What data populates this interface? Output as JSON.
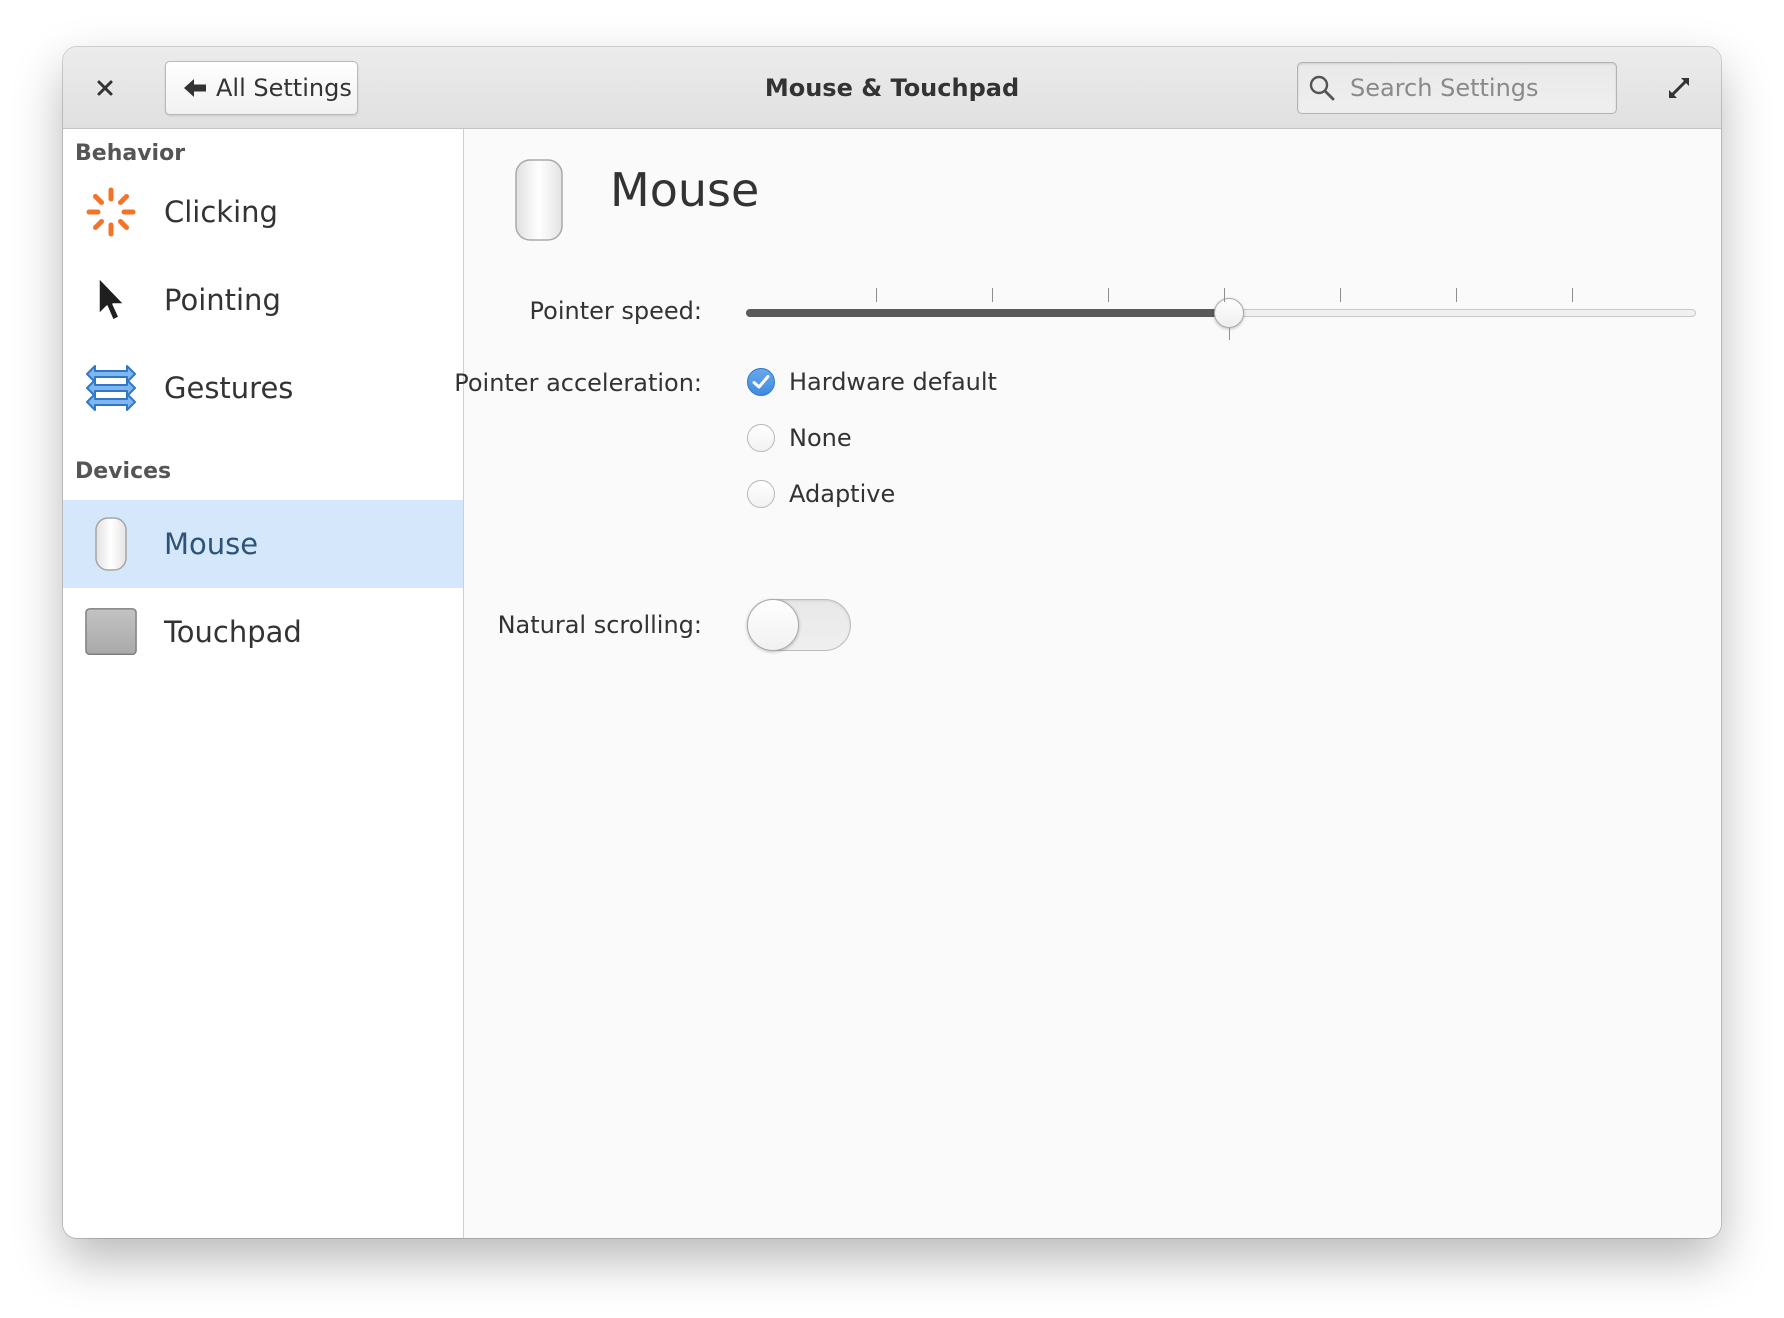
{
  "window": {
    "title": "Mouse & Touchpad"
  },
  "header": {
    "close_icon": "close-icon",
    "back_label": "All Settings",
    "back_icon": "arrow-left-icon",
    "search_placeholder": "Search Settings",
    "search_value": "",
    "maximize_icon": "maximize-icon"
  },
  "sidebar": {
    "sections": [
      {
        "title": "Behavior",
        "items": [
          {
            "label": "Clicking",
            "icon": "clicking-icon",
            "selected": false
          },
          {
            "label": "Pointing",
            "icon": "pointer-icon",
            "selected": false
          },
          {
            "label": "Gestures",
            "icon": "gestures-icon",
            "selected": false
          }
        ]
      },
      {
        "title": "Devices",
        "items": [
          {
            "label": "Mouse",
            "icon": "mouse-icon",
            "selected": true
          },
          {
            "label": "Touchpad",
            "icon": "touchpad-icon",
            "selected": false
          }
        ]
      }
    ]
  },
  "main": {
    "title": "Mouse",
    "icon": "mouse-icon",
    "pointer_speed": {
      "label": "Pointer speed:",
      "value_fraction": 0.5,
      "tick_count": 7
    },
    "pointer_acceleration": {
      "label": "Pointer acceleration:",
      "options": [
        {
          "label": "Hardware default",
          "checked": true
        },
        {
          "label": "None",
          "checked": false
        },
        {
          "label": "Adaptive",
          "checked": false
        }
      ]
    },
    "natural_scrolling": {
      "label": "Natural scrolling:",
      "on": false
    }
  },
  "colors": {
    "accent": "#3f8be0",
    "selection": "#d5e8fb",
    "clicking_icon": "#f37329",
    "gestures_icon": "#3d8de4"
  }
}
